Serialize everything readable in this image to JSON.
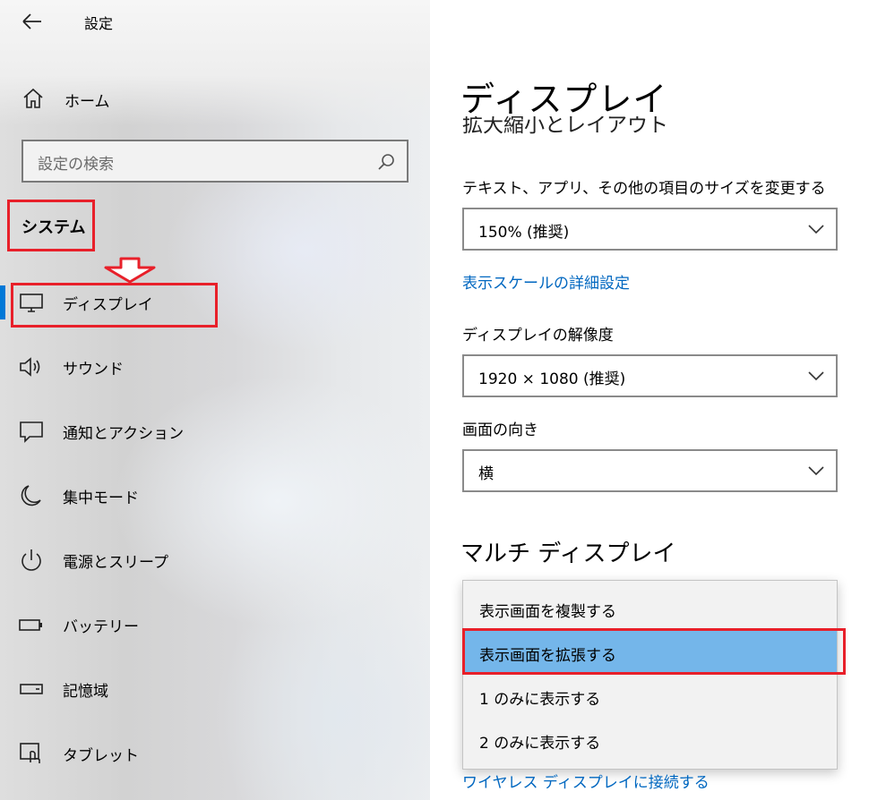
{
  "app": {
    "title": "設定"
  },
  "sidebar": {
    "home_label": "ホーム",
    "search_placeholder": "設定の検索",
    "section_heading": "システム",
    "items": [
      {
        "label": "ディスプレイ",
        "icon": "monitor-icon",
        "active": true
      },
      {
        "label": "サウンド",
        "icon": "speaker-icon"
      },
      {
        "label": "通知とアクション",
        "icon": "message-icon"
      },
      {
        "label": "集中モード",
        "icon": "moon-icon"
      },
      {
        "label": "電源とスリープ",
        "icon": "power-icon"
      },
      {
        "label": "バッテリー",
        "icon": "battery-icon"
      },
      {
        "label": "記憶域",
        "icon": "drive-icon"
      },
      {
        "label": "タブレット",
        "icon": "tablet-icon"
      }
    ]
  },
  "main": {
    "title": "ディスプレイ",
    "partial_heading": "拡大縮小とレイアウト",
    "scale": {
      "label": "テキスト、アプリ、その他の項目のサイズを変更する",
      "value": "150% (推奨)",
      "advanced_link": "表示スケールの詳細設定"
    },
    "resolution": {
      "label": "ディスプレイの解像度",
      "value": "1920 × 1080 (推奨)"
    },
    "orientation": {
      "label": "画面の向き",
      "value": "横"
    },
    "multi_display": {
      "heading": "マルチ ディスプレイ",
      "options": [
        {
          "label": "表示画面を複製する"
        },
        {
          "label": "表示画面を拡張する",
          "selected": true
        },
        {
          "label": "1 のみに表示する"
        },
        {
          "label": "2 のみに表示する"
        }
      ],
      "wireless_link": "ワイヤレス ディスプレイに接続する"
    }
  },
  "colors": {
    "accent": "#0078d7",
    "link": "#0067c0",
    "highlight": "#e8202a",
    "selected_option": "#74b6ea"
  }
}
